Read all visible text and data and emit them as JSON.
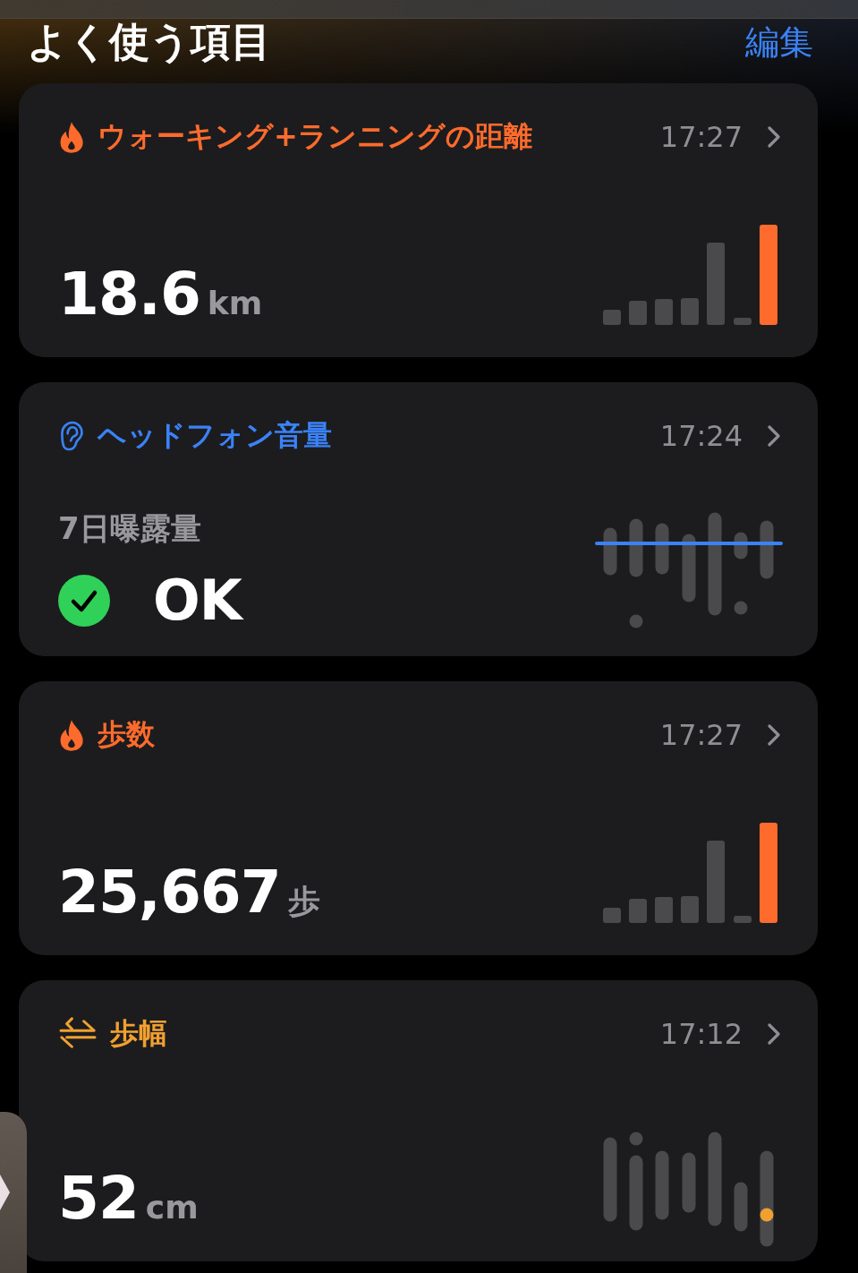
{
  "header": {
    "title": "よく使う項目",
    "edit_link": "編集"
  },
  "cards": [
    {
      "kind": "distance",
      "color": "#ff6b2c",
      "title": "ウォーキング+ランニングの距離",
      "time": "17:27",
      "value": "18.6",
      "unit": "km"
    },
    {
      "kind": "headphone",
      "color": "#3a82f7",
      "title": "ヘッドフォン音量",
      "time": "17:24",
      "subtitle": "7日曝露量",
      "value": "OK"
    },
    {
      "kind": "steps",
      "color": "#ff6b2c",
      "title": "歩数",
      "time": "17:27",
      "value": "25,667",
      "unit": "歩"
    },
    {
      "kind": "stride",
      "color": "#f0a030",
      "title": "歩幅",
      "time": "17:12",
      "value": "52",
      "unit": "cm"
    }
  ]
}
